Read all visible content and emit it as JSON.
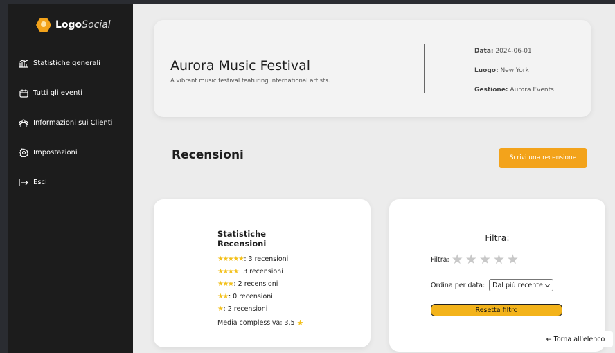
{
  "brand": {
    "logo_bold": "Logo",
    "logo_italic": "Social"
  },
  "sidebar": {
    "items": [
      {
        "label": "Statistiche generali",
        "icon": "bar-chart-icon"
      },
      {
        "label": "Tutti gli eventi",
        "icon": "calendar-icon"
      },
      {
        "label": "Informazioni sui Clienti",
        "icon": "users-icon"
      },
      {
        "label": "Impostazioni",
        "icon": "gear-icon"
      },
      {
        "label": "Esci",
        "icon": "logout-icon"
      }
    ]
  },
  "event": {
    "title": "Aurora Music Festival",
    "description": "A vibrant music festival featuring international artists.",
    "date_label": "Data:",
    "date_value": "2024-06-01",
    "place_label": "Luogo:",
    "place_value": "New York",
    "manager_label": "Gestione:",
    "manager_value": "Aurora Events"
  },
  "reviews": {
    "section_title": "Recensioni",
    "write_button": "Scrivi una recensione"
  },
  "stats": {
    "title_line1": "Statistiche",
    "title_line2": "Recensioni",
    "rows": [
      {
        "stars": "★★★★★",
        "text": ": 3 recensioni"
      },
      {
        "stars": "★★★★",
        "text": ": 3 recensioni"
      },
      {
        "stars": "★★★",
        "text": ": 2 recensioni"
      },
      {
        "stars": "★★",
        "text": ": 0 recensioni"
      },
      {
        "stars": "★",
        "text": ": 2 recensioni"
      }
    ],
    "average_label": "Media complessiva: 3.5"
  },
  "filter": {
    "title": "Filtra:",
    "stars_label": "Filtra:",
    "star_count_shown": 5,
    "order_label": "Ordina per data:",
    "order_selected": "Dal più recente",
    "reset_button": "Resetta filtro"
  },
  "back_link": "← Torna all'elenco",
  "colors": {
    "accent": "#f3a31b",
    "sidebar": "#1c1c1c",
    "star": "#f3c01b",
    "star_inactive": "#c8c8c8"
  }
}
